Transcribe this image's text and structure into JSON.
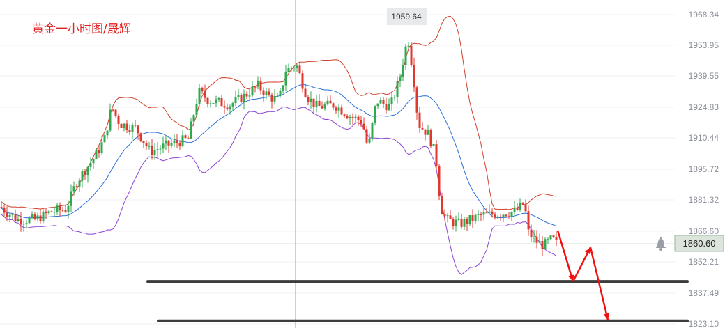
{
  "chart_data": {
    "type": "candlestick",
    "title": "黄金一小时图/晟辉",
    "y_ticks": [
      "1968.34",
      "1953.95",
      "1939.55",
      "1924.83",
      "1910.44",
      "1895.72",
      "1881.32",
      "1866.60",
      "1852.21",
      "1837.49",
      "1823.10"
    ],
    "ylim": [
      1823.1,
      1968.34
    ],
    "grid": true,
    "last_price": 1860.6,
    "last_price_label": "1860.60",
    "high_marker": 1959.64,
    "high_marker_label": "1959.64",
    "support_levels": [
      1843.0,
      1824.5
    ],
    "colors": {
      "bull": "#2fa84f",
      "bear": "#e0382e",
      "upper_band": "#d0402a",
      "mid_band": "#2a6fdb",
      "lower_band": "#8b45d6",
      "support": "#3c3c3c",
      "arrow": "#f01010",
      "title": "#e0201e"
    },
    "anchors": [
      [
        0,
        1878
      ],
      [
        25,
        1872
      ],
      [
        50,
        1872
      ],
      [
        75,
        1876
      ],
      [
        95,
        1877
      ],
      [
        110,
        1890
      ],
      [
        135,
        1901
      ],
      [
        150,
        1910
      ],
      [
        160,
        1925
      ],
      [
        172,
        1917
      ],
      [
        195,
        1915
      ],
      [
        215,
        1904
      ],
      [
        240,
        1907
      ],
      [
        270,
        1910
      ],
      [
        285,
        1932
      ],
      [
        300,
        1928
      ],
      [
        330,
        1926
      ],
      [
        350,
        1930
      ],
      [
        370,
        1935
      ],
      [
        385,
        1930
      ],
      [
        400,
        1928
      ],
      [
        410,
        1942
      ],
      [
        425,
        1945
      ],
      [
        440,
        1930
      ],
      [
        455,
        1925
      ],
      [
        480,
        1926
      ],
      [
        500,
        1921
      ],
      [
        520,
        1918
      ],
      [
        528,
        1905
      ],
      [
        540,
        1928
      ],
      [
        560,
        1925
      ],
      [
        573,
        1938
      ],
      [
        585,
        1958
      ],
      [
        593,
        1940
      ],
      [
        600,
        1917
      ],
      [
        615,
        1912
      ],
      [
        625,
        1902
      ],
      [
        632,
        1878
      ],
      [
        640,
        1872
      ],
      [
        660,
        1870
      ],
      [
        690,
        1874
      ],
      [
        720,
        1875
      ],
      [
        740,
        1876
      ],
      [
        752,
        1880
      ],
      [
        758,
        1866
      ],
      [
        768,
        1862
      ],
      [
        780,
        1860
      ],
      [
        792,
        1863
      ],
      [
        800,
        1860
      ]
    ],
    "arrows": [
      [
        [
          800,
          1867
        ],
        [
          822,
          1843
        ]
      ],
      [
        [
          822,
          1843
        ],
        [
          847,
          1859
        ]
      ],
      [
        [
          847,
          1859
        ],
        [
          872,
          1825
        ]
      ]
    ]
  }
}
